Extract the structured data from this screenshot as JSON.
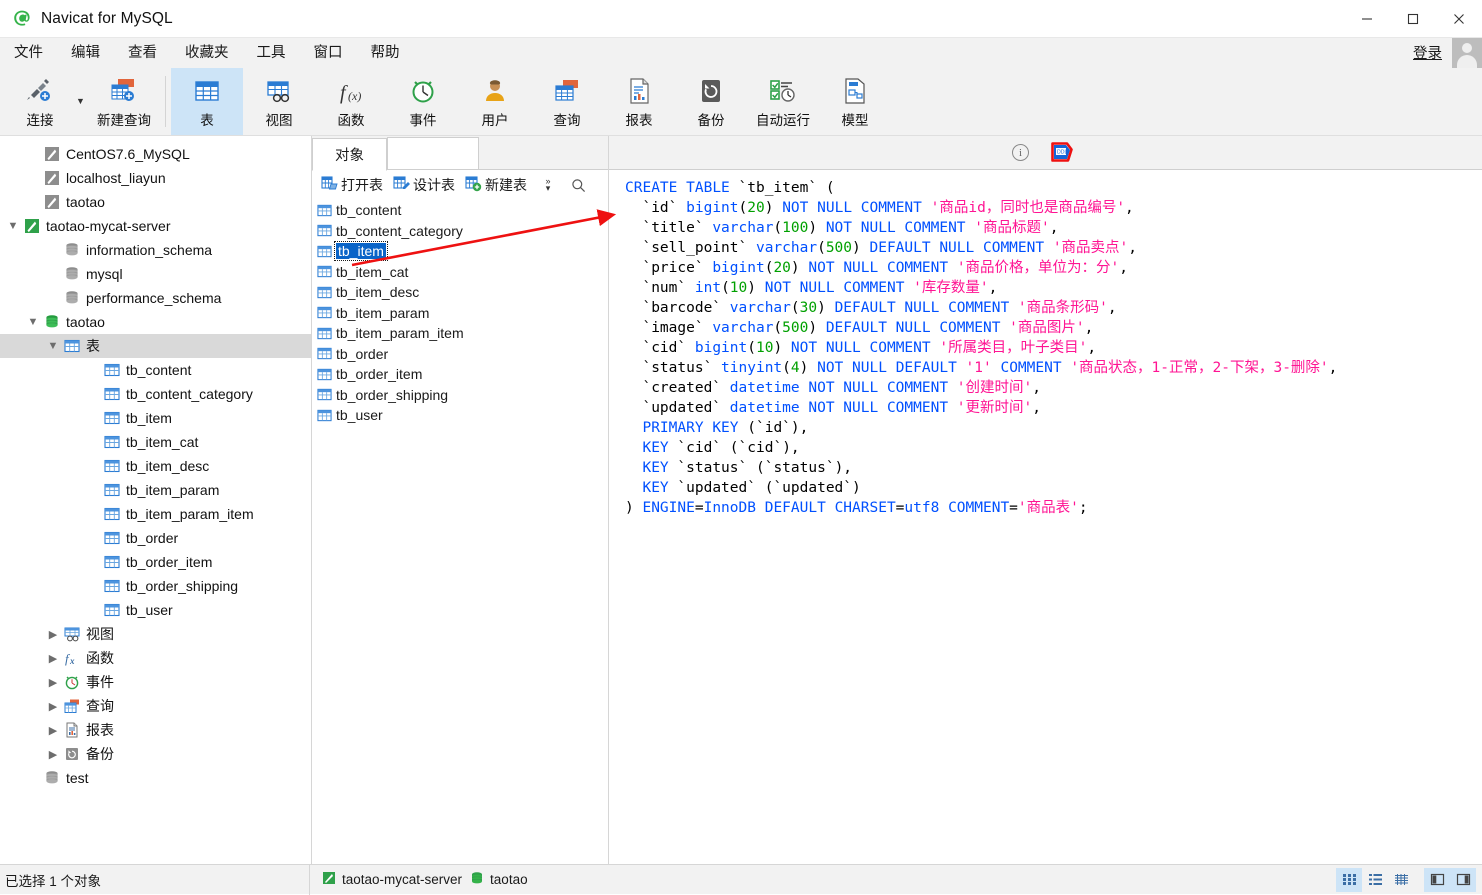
{
  "window": {
    "title": "Navicat for MySQL",
    "logo_icon": "navicat-logo-icon",
    "minimize_icon": "minimize-icon",
    "maximize_icon": "maximize-icon",
    "close_icon": "close-icon"
  },
  "menubar": {
    "items": [
      {
        "label": "文件",
        "name": "menu-file"
      },
      {
        "label": "编辑",
        "name": "menu-edit"
      },
      {
        "label": "查看",
        "name": "menu-view"
      },
      {
        "label": "收藏夹",
        "name": "menu-favorites"
      },
      {
        "label": "工具",
        "name": "menu-tools"
      },
      {
        "label": "窗口",
        "name": "menu-window"
      },
      {
        "label": "帮助",
        "name": "menu-help"
      }
    ],
    "login_label": "登录",
    "avatar_icon": "user-avatar-icon"
  },
  "toolbar": {
    "buttons": [
      {
        "label": "连接",
        "icon": "connection-icon",
        "active": false
      },
      {
        "label": "新建查询",
        "icon": "new-query-icon",
        "active": false
      },
      {
        "label": "表",
        "icon": "table-icon",
        "active": true
      },
      {
        "label": "视图",
        "icon": "view-icon",
        "active": false
      },
      {
        "label": "函数",
        "icon": "function-icon",
        "active": false
      },
      {
        "label": "事件",
        "icon": "event-clock-icon",
        "active": false
      },
      {
        "label": "用户",
        "icon": "user-icon",
        "active": false
      },
      {
        "label": "查询",
        "icon": "query-icon",
        "active": false
      },
      {
        "label": "报表",
        "icon": "report-icon",
        "active": false
      },
      {
        "label": "备份",
        "icon": "backup-icon",
        "active": false
      },
      {
        "label": "自动运行",
        "icon": "automation-icon",
        "active": false
      },
      {
        "label": "模型",
        "icon": "model-icon",
        "active": false
      }
    ]
  },
  "tree": {
    "nodes": [
      {
        "label": "CentOS7.6_MySQL",
        "indent": 1,
        "icon": "connection-gray-icon",
        "twisty": "",
        "selected": false
      },
      {
        "label": "localhost_liayun",
        "indent": 1,
        "icon": "connection-gray-icon",
        "twisty": "",
        "selected": false
      },
      {
        "label": "taotao",
        "indent": 1,
        "icon": "connection-gray-icon",
        "twisty": "",
        "selected": false
      },
      {
        "label": "taotao-mycat-server",
        "indent": 0,
        "icon": "connection-green-icon",
        "twisty": "▼",
        "selected": false
      },
      {
        "label": "information_schema",
        "indent": 2,
        "icon": "database-gray-icon",
        "twisty": "",
        "selected": false
      },
      {
        "label": "mysql",
        "indent": 2,
        "icon": "database-gray-icon",
        "twisty": "",
        "selected": false
      },
      {
        "label": "performance_schema",
        "indent": 2,
        "icon": "database-gray-icon",
        "twisty": "",
        "selected": false
      },
      {
        "label": "taotao",
        "indent": 1,
        "icon": "database-green-icon",
        "twisty": "▼",
        "selected": false
      },
      {
        "label": "表",
        "indent": 2,
        "icon": "table-folder-icon",
        "twisty": "▼",
        "selected": true
      },
      {
        "label": "tb_content",
        "indent": 4,
        "icon": "table-item-icon",
        "twisty": "",
        "selected": false
      },
      {
        "label": "tb_content_category",
        "indent": 4,
        "icon": "table-item-icon",
        "twisty": "",
        "selected": false
      },
      {
        "label": "tb_item",
        "indent": 4,
        "icon": "table-item-icon",
        "twisty": "",
        "selected": false
      },
      {
        "label": "tb_item_cat",
        "indent": 4,
        "icon": "table-item-icon",
        "twisty": "",
        "selected": false
      },
      {
        "label": "tb_item_desc",
        "indent": 4,
        "icon": "table-item-icon",
        "twisty": "",
        "selected": false
      },
      {
        "label": "tb_item_param",
        "indent": 4,
        "icon": "table-item-icon",
        "twisty": "",
        "selected": false
      },
      {
        "label": "tb_item_param_item",
        "indent": 4,
        "icon": "table-item-icon",
        "twisty": "",
        "selected": false
      },
      {
        "label": "tb_order",
        "indent": 4,
        "icon": "table-item-icon",
        "twisty": "",
        "selected": false
      },
      {
        "label": "tb_order_item",
        "indent": 4,
        "icon": "table-item-icon",
        "twisty": "",
        "selected": false
      },
      {
        "label": "tb_order_shipping",
        "indent": 4,
        "icon": "table-item-icon",
        "twisty": "",
        "selected": false
      },
      {
        "label": "tb_user",
        "indent": 4,
        "icon": "table-item-icon",
        "twisty": "",
        "selected": false
      },
      {
        "label": "视图",
        "indent": 2,
        "icon": "views-icon",
        "twisty": "▶",
        "selected": false
      },
      {
        "label": "函数",
        "indent": 2,
        "icon": "functions-icon",
        "twisty": "▶",
        "selected": false
      },
      {
        "label": "事件",
        "indent": 2,
        "icon": "events-icon",
        "twisty": "▶",
        "selected": false
      },
      {
        "label": "查询",
        "indent": 2,
        "icon": "queries-icon",
        "twisty": "▶",
        "selected": false
      },
      {
        "label": "报表",
        "indent": 2,
        "icon": "reports-icon",
        "twisty": "▶",
        "selected": false
      },
      {
        "label": "备份",
        "indent": 2,
        "icon": "backups-icon",
        "twisty": "▶",
        "selected": false
      },
      {
        "label": "test",
        "indent": 1,
        "icon": "database-gray-icon",
        "twisty": "",
        "selected": false
      }
    ]
  },
  "objects": {
    "tab_label": "对象",
    "actions": [
      {
        "label": "打开表",
        "icon": "open-table-icon"
      },
      {
        "label": "设计表",
        "icon": "design-table-icon"
      },
      {
        "label": "新建表",
        "icon": "new-table-icon"
      }
    ],
    "more_icon": "chevron-more-icon",
    "search_icon": "search-icon",
    "items": [
      {
        "label": "tb_content",
        "selected": false
      },
      {
        "label": "tb_content_category",
        "selected": false
      },
      {
        "label": "tb_item",
        "selected": true
      },
      {
        "label": "tb_item_cat",
        "selected": false
      },
      {
        "label": "tb_item_desc",
        "selected": false
      },
      {
        "label": "tb_item_param",
        "selected": false
      },
      {
        "label": "tb_item_param_item",
        "selected": false
      },
      {
        "label": "tb_order",
        "selected": false
      },
      {
        "label": "tb_order_item",
        "selected": false
      },
      {
        "label": "tb_order_shipping",
        "selected": false
      },
      {
        "label": "tb_user",
        "selected": false
      }
    ]
  },
  "sql_panel": {
    "info_icon": "info-icon",
    "ddl_icon": "ddl-icon",
    "ddl_label": "DDL",
    "sql_text": "CREATE TABLE `tb_item` (\n  `id` bigint(20) NOT NULL COMMENT '商品id，同时也是商品编号',\n  `title` varchar(100) NOT NULL COMMENT '商品标题',\n  `sell_point` varchar(500) DEFAULT NULL COMMENT '商品卖点',\n  `price` bigint(20) NOT NULL COMMENT '商品价格，单位为：分',\n  `num` int(10) NOT NULL COMMENT '库存数量',\n  `barcode` varchar(30) DEFAULT NULL COMMENT '商品条形码',\n  `image` varchar(500) DEFAULT NULL COMMENT '商品图片',\n  `cid` bigint(10) NOT NULL COMMENT '所属类目，叶子类目',\n  `status` tinyint(4) NOT NULL DEFAULT '1' COMMENT '商品状态，1-正常，2-下架，3-删除',\n  `created` datetime NOT NULL COMMENT '创建时间',\n  `updated` datetime NOT NULL COMMENT '更新时间',\n  PRIMARY KEY (`id`),\n  KEY `cid` (`cid`),\n  KEY `status` (`status`),\n  KEY `updated` (`updated`)\n) ENGINE=InnoDB DEFAULT CHARSET=utf8 COMMENT='商品表';"
  },
  "statusbar": {
    "selection_text": "已选择 1 个对象",
    "server_name": "taotao-mycat-server",
    "server_icon": "connection-green-icon",
    "database_name": "taotao",
    "database_icon": "database-green-icon",
    "view_buttons": [
      {
        "name": "grid-view-button",
        "icon": "grid-icon",
        "active": true
      },
      {
        "name": "list-view-button",
        "icon": "list-icon",
        "active": false
      },
      {
        "name": "detail-view-button",
        "icon": "detail-icon",
        "active": false
      },
      {
        "name": "left-pane-toggle",
        "icon": "pane-left-icon",
        "active": true
      },
      {
        "name": "right-pane-toggle",
        "icon": "pane-right-icon",
        "active": true
      }
    ]
  },
  "colors": {
    "accent": "#0a64c8",
    "toolbar_active": "#cde4f7",
    "annotation_red": "#ee1111",
    "sql_keyword": "#0050ff",
    "sql_number": "#00a000",
    "sql_string": "#ff1493"
  }
}
